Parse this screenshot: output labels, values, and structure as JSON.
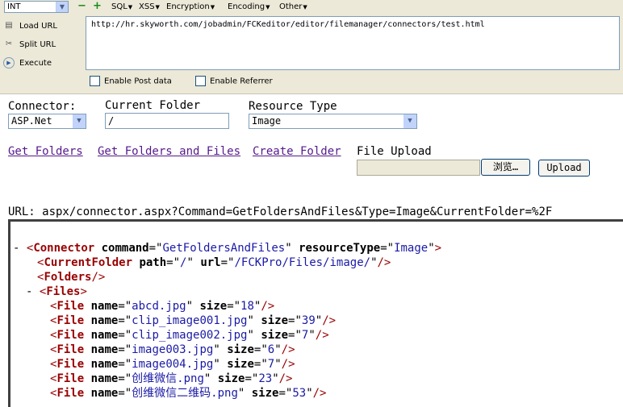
{
  "hackbar": {
    "select_value": "INT",
    "minus": "−",
    "plus": "+",
    "menus": [
      "SQL",
      "XSS",
      "Encryption",
      "Encoding",
      "Other"
    ],
    "actions": [
      "Load URL",
      "Split URL",
      "Execute"
    ],
    "url": "http://hr.skyworth.com/jobadmin/FCKeditor/editor/filemanager/connectors/test.html",
    "enable_post": "Enable Post data",
    "enable_referrer": "Enable Referrer"
  },
  "form": {
    "connector_label": "Connector:",
    "connector_value": "ASP.Net",
    "folder_label": "Current Folder",
    "folder_value": "/",
    "resource_label": "Resource Type",
    "resource_value": "Image",
    "links": [
      "Get Folders",
      "Get Folders and Files",
      "Create Folder"
    ],
    "upload_label": "File Upload",
    "browse_button": "浏览…",
    "upload_button": "Upload"
  },
  "url_line": "URL: aspx/connector.aspx?Command=GetFoldersAndFiles&Type=Image&CurrentFolder=%2F",
  "xml": {
    "connector": {
      "tag": "Connector",
      "command": "GetFoldersAndFiles",
      "resourceType": "Image"
    },
    "current_folder": {
      "tag": "CurrentFolder",
      "path": "/",
      "url": "/FCKPro/Files/image/"
    },
    "folders_tag": "Folders",
    "files_tag": "Files",
    "files": [
      {
        "name": "abcd.jpg",
        "size": "18"
      },
      {
        "name": "clip_image001.jpg",
        "size": "39"
      },
      {
        "name": "clip_image002.jpg",
        "size": "7"
      },
      {
        "name": "image003.jpg",
        "size": "6"
      },
      {
        "name": "image004.jpg",
        "size": "7"
      },
      {
        "name": "创维微信.png",
        "size": "23"
      },
      {
        "name": "创维微信二维码.png",
        "size": "53"
      }
    ]
  }
}
